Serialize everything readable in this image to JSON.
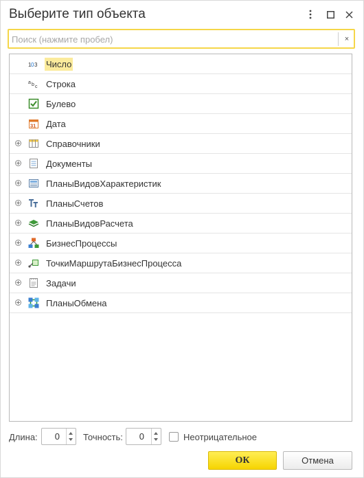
{
  "window": {
    "title": "Выберите тип объекта",
    "more_glyph": "⋮",
    "maximize_glyph": "□",
    "close_glyph": "✕"
  },
  "search": {
    "placeholder": "Поиск (нажмите пробел)",
    "value": "",
    "clear_glyph": "×"
  },
  "tree": {
    "items": [
      {
        "label": "Число",
        "icon": "number-icon",
        "expandable": false,
        "selected": true
      },
      {
        "label": "Строка",
        "icon": "string-icon",
        "expandable": false,
        "selected": false
      },
      {
        "label": "Булево",
        "icon": "boolean-checkbox-icon",
        "expandable": false,
        "selected": false
      },
      {
        "label": "Дата",
        "icon": "calendar-date-icon",
        "expandable": false,
        "selected": false
      },
      {
        "label": "Справочники",
        "icon": "catalog-table-icon",
        "expandable": true,
        "selected": false
      },
      {
        "label": "Документы",
        "icon": "document-icon",
        "expandable": true,
        "selected": false
      },
      {
        "label": "ПланыВидовХарактеристик",
        "icon": "characteristics-plan-icon",
        "expandable": true,
        "selected": false
      },
      {
        "label": "ПланыСчетов",
        "icon": "accounts-plan-icon",
        "expandable": true,
        "selected": false
      },
      {
        "label": "ПланыВидовРасчета",
        "icon": "calculation-plan-layers-icon",
        "expandable": true,
        "selected": false
      },
      {
        "label": "БизнесПроцессы",
        "icon": "business-process-icon",
        "expandable": true,
        "selected": false
      },
      {
        "label": "ТочкиМаршрутаБизнесПроцесса",
        "icon": "route-point-icon",
        "expandable": true,
        "selected": false
      },
      {
        "label": "Задачи",
        "icon": "task-icon",
        "expandable": true,
        "selected": false
      },
      {
        "label": "ПланыОбмена",
        "icon": "exchange-plan-icon",
        "expandable": true,
        "selected": false
      }
    ]
  },
  "params": {
    "length_label": "Длина:",
    "length_value": "0",
    "precision_label": "Точность:",
    "precision_value": "0",
    "nonnegative_label": "Неотрицательное",
    "nonnegative_checked": false
  },
  "buttons": {
    "ok": "ОК",
    "cancel": "Отмена"
  },
  "colors": {
    "selection": "#fbeb9c",
    "ok_button": "#f6d400",
    "search_focus_border": "#f5d649"
  }
}
